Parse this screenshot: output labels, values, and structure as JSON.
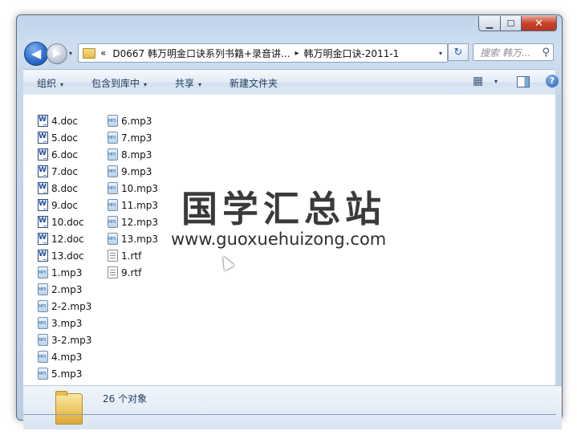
{
  "window": {
    "controls": {
      "minimize": "▁",
      "maximize": "☐",
      "close": "✕"
    }
  },
  "navigation": {
    "back_glyph": "◀",
    "forward_glyph": "▶",
    "dropdown_glyph": "▾"
  },
  "address": {
    "overflow": "«",
    "crumbs": [
      "D0667 韩万明金口诀系列书籍+录音讲...",
      "韩万明金口诀-2011-1"
    ],
    "separator": "▸",
    "dropdown_glyph": "▾",
    "refresh_glyph": "↻"
  },
  "search": {
    "placeholder": "搜索 韩万...",
    "icon": "search-icon",
    "icon_glyph": "⚲"
  },
  "toolbar": {
    "organize": "组织",
    "include_in_library": "包含到库中",
    "share": "共享",
    "new_folder": "新建文件夹",
    "caret": "▾",
    "view_glyph": "▦",
    "help_glyph": "?"
  },
  "files": {
    "column1": [
      {
        "name": "4.doc",
        "type": "doc"
      },
      {
        "name": "5.doc",
        "type": "doc"
      },
      {
        "name": "6.doc",
        "type": "doc"
      },
      {
        "name": "7.doc",
        "type": "doc"
      },
      {
        "name": "8.doc",
        "type": "doc"
      },
      {
        "name": "9.doc",
        "type": "doc"
      },
      {
        "name": "10.doc",
        "type": "doc"
      },
      {
        "name": "12.doc",
        "type": "doc"
      },
      {
        "name": "13.doc",
        "type": "doc"
      },
      {
        "name": "1.mp3",
        "type": "mp3"
      },
      {
        "name": "2.mp3",
        "type": "mp3"
      },
      {
        "name": "2-2.mp3",
        "type": "mp3"
      },
      {
        "name": "3.mp3",
        "type": "mp3"
      },
      {
        "name": "3-2.mp3",
        "type": "mp3"
      },
      {
        "name": "4.mp3",
        "type": "mp3"
      },
      {
        "name": "5.mp3",
        "type": "mp3"
      }
    ],
    "column2": [
      {
        "name": "6.mp3",
        "type": "mp3"
      },
      {
        "name": "7.mp3",
        "type": "mp3"
      },
      {
        "name": "8.mp3",
        "type": "mp3"
      },
      {
        "name": "9.mp3",
        "type": "mp3"
      },
      {
        "name": "10.mp3",
        "type": "mp3"
      },
      {
        "name": "11.mp3",
        "type": "mp3"
      },
      {
        "name": "12.mp3",
        "type": "mp3"
      },
      {
        "name": "13.mp3",
        "type": "mp3"
      },
      {
        "name": "1.rtf",
        "type": "rtf"
      },
      {
        "name": "9.rtf",
        "type": "rtf"
      }
    ]
  },
  "watermark": {
    "title": "国学汇总站",
    "url": "www.guoxuehuizong.com"
  },
  "details": {
    "count_text": "26 个对象"
  }
}
